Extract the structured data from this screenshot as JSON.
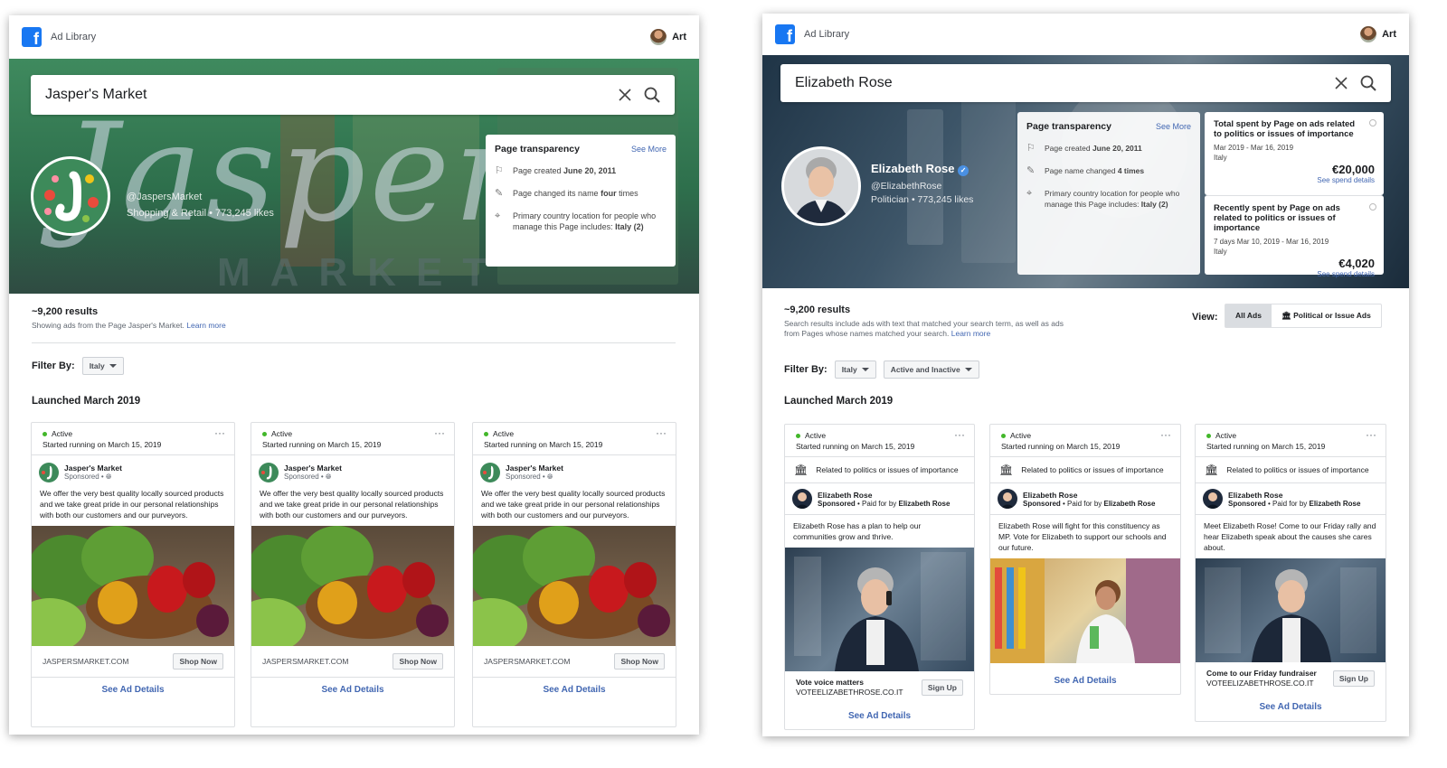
{
  "app": {
    "title": "Ad Library",
    "user": "Art"
  },
  "left": {
    "search_value": "Jasper's Market",
    "hero_text": "Jasper",
    "hero_subtext": "MARKET",
    "page_handle": "@JaspersMarket",
    "page_meta": "Shopping & Retail • 773,245 likes",
    "transparency": {
      "title": "Page transparency",
      "see_more": "See More",
      "created_prefix": "Page created ",
      "created_date": "June 20, 2011",
      "changed_prefix": "Page changed its name ",
      "changed_count": "four",
      "changed_suffix": " times",
      "country_text": "Primary country location for people who manage this Page includes: ",
      "country": "Italy (2)"
    },
    "results_count": "~9,200 results",
    "results_note": "Showing ads from the Page Jasper's Market.",
    "learn_more": "Learn more",
    "filter_label": "Filter By:",
    "filter_country": "Italy",
    "section_title": "Launched March 2019",
    "ads": [
      {
        "status": "Active",
        "started": "Started running on March 15, 2019",
        "page": "Jasper's Market",
        "sponsored": "Sponsored • ",
        "body": "We offer the very best quality locally sourced products and we take great pride in our personal relationships with both our customers and our purveyors.",
        "domain": "JASPERSMARKET.COM",
        "cta": "Shop Now",
        "details": "See Ad Details"
      },
      {
        "status": "Active",
        "started": "Started running on March 15, 2019",
        "page": "Jasper's Market",
        "sponsored": "Sponsored • ",
        "body": "We offer the very best quality locally sourced products and we take great pride in our personal relationships with both our customers and our purveyors.",
        "domain": "JASPERSMARKET.COM",
        "cta": "Shop Now",
        "details": "See Ad Details"
      },
      {
        "status": "Active",
        "started": "Started running on March 15, 2019",
        "page": "Jasper's Market",
        "sponsored": "Sponsored • ",
        "body": "We offer the very best quality locally sourced products and we take great pride in our personal relationships with both our customers and our purveyors.",
        "domain": "JASPERSMARKET.COM",
        "cta": "Shop Now",
        "details": "See Ad Details"
      }
    ]
  },
  "right": {
    "search_value": "Elizabeth Rose",
    "page_name": "Elizabeth Rose",
    "page_handle": "@ElizabethRose",
    "page_meta": "Politician • 773,245 likes",
    "transparency": {
      "title": "Page transparency",
      "see_more": "See More",
      "created_prefix": "Page created ",
      "created_date": "June 20, 2011",
      "changed_prefix": "Page name changed ",
      "changed_count": "4 times",
      "country_text": "Primary country location for people who manage this Page includes: ",
      "country": "Italy (2)"
    },
    "spend_total": {
      "title": "Total spent by Page on ads related to politics or issues of importance",
      "dates": "Mar 2019 - Mar 16, 2019",
      "country": "Italy",
      "amount": "€20,000",
      "link": "See spend details"
    },
    "spend_recent": {
      "title": "Recently spent by Page on ads related to politics or issues of importance",
      "dates": "7 days  Mar 10, 2019 - Mar 16, 2019",
      "country": "Italy",
      "amount": "€4,020",
      "link": "See spend details"
    },
    "results_count": "~9,200 results",
    "results_note": "Search results include ads with text that matched your search term, as well as ads from Pages whose names matched your search.",
    "learn_more": "Learn more",
    "view_label": "View:",
    "view_all": "All Ads",
    "view_political": "Political or Issue Ads",
    "filter_label": "Filter By:",
    "filter_country": "Italy",
    "filter_status": "Active and Inactive",
    "section_title": "Launched March 2019",
    "ads": [
      {
        "status": "Active",
        "started": "Started running on March 15, 2019",
        "political": "Related to politics or issues of importance",
        "page": "Elizabeth Rose",
        "sponsored": "Sponsored",
        "paid_prefix": " • Paid for by ",
        "paid_by": "Elizabeth Rose",
        "body": "Elizabeth Rose has a plan to help our communities grow and thrive.",
        "headline": "Vote voice matters",
        "domain": "VOTEELIZABETHROSE.CO.IT",
        "cta": "Sign Up",
        "details": "See Ad Details"
      },
      {
        "status": "Active",
        "started": "Started running on March 15, 2019",
        "political": "Related to politics or issues of importance",
        "page": "Elizabeth Rose",
        "sponsored": "Sponsored",
        "paid_prefix": " • Paid for by ",
        "paid_by": "Elizabeth Rose",
        "body": "Elizabeth Rose will fight for this constituency as MP. Vote for Elizabeth to support our schools and our future.",
        "details": "See Ad Details"
      },
      {
        "status": "Active",
        "started": "Started running on March 15, 2019",
        "political": "Related to politics or issues of importance",
        "page": "Elizabeth Rose",
        "sponsored": "Sponsored",
        "paid_prefix": " • Paid for by ",
        "paid_by": "Elizabeth Rose",
        "body": "Meet Elizabeth Rose! Come to our Friday rally and hear Elizabeth speak about the causes she cares about.",
        "headline": "Come to our Friday fundraiser",
        "domain": "VOTEELIZABETHROSE.CO.IT",
        "cta": "Sign Up",
        "details": "See Ad Details"
      }
    ]
  },
  "icons": {
    "logo": "facebook-logo-icon",
    "clear": "close-icon",
    "search": "search-icon",
    "flag": "flag-icon",
    "edit": "edit-icon",
    "location": "location-pin-icon",
    "globe": "globe-icon",
    "bank": "bank-building-icon",
    "verified": "verified-badge-icon",
    "more": "more-options-icon",
    "info": "info-icon"
  },
  "colors": {
    "facebook_blue": "#1877f2",
    "link": "#4267b2",
    "active": "#42b72a"
  }
}
